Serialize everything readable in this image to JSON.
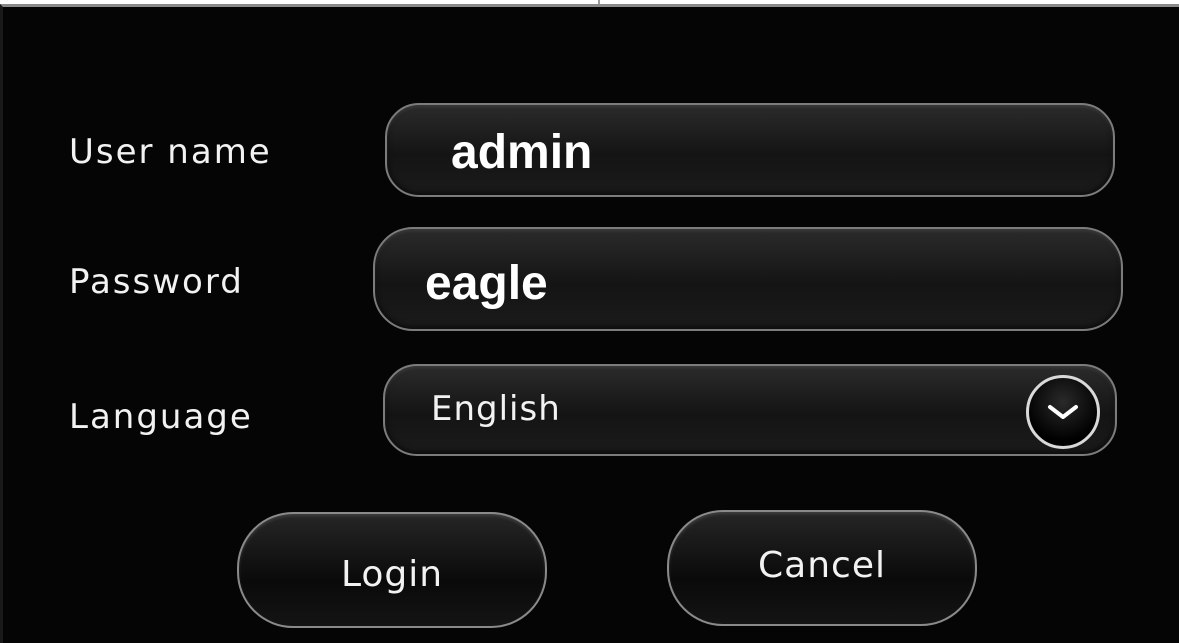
{
  "form": {
    "username": {
      "label": "User name",
      "value": "admin"
    },
    "password": {
      "label": "Password",
      "value": "eagle"
    },
    "language": {
      "label": "Language",
      "selected": "English",
      "dropdown_icon": "chevron-down-icon"
    }
  },
  "actions": {
    "login_label": "Login",
    "cancel_label": "Cancel"
  },
  "colors": {
    "background": "#050505",
    "text": "#f2f2f2",
    "border": "#7c7c7c"
  }
}
